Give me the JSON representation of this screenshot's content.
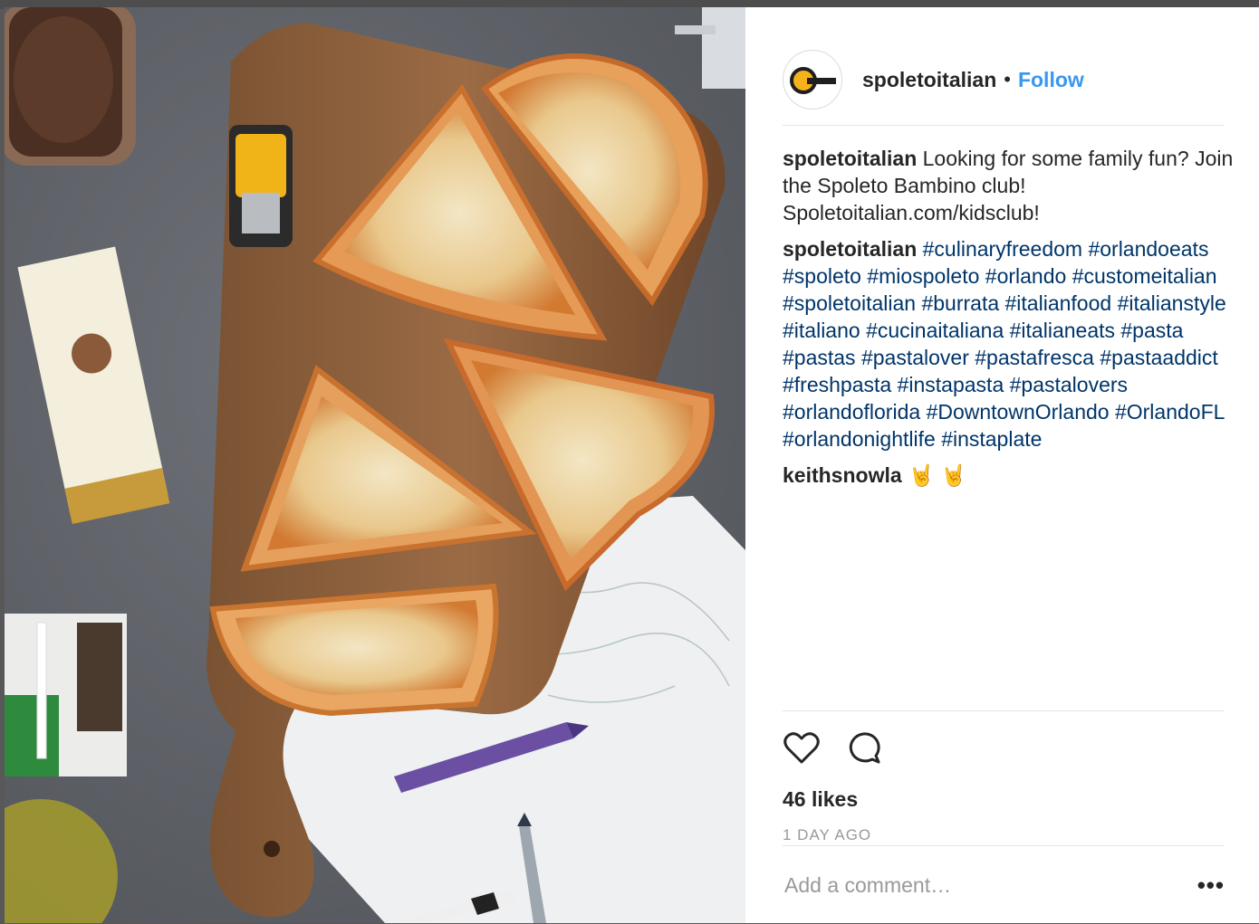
{
  "post": {
    "username": "spoletoitalian",
    "separator": "•",
    "follow_label": "Follow",
    "image_alt": "Pizza slices on a wooden board"
  },
  "comments": [
    {
      "author": "spoletoitalian",
      "text": " Looking for some family fun? Join the Spoleto Bambino club! Spoletoitalian.com/kidsclub!"
    },
    {
      "author": "spoletoitalian",
      "hashtags": [
        "#culinaryfreedom",
        "#orlandoeats",
        "#spoleto",
        "#miospoleto",
        "#orlando",
        "#customeitalian",
        "#spoletoitalian",
        "#burrata",
        "#italianfood",
        "#italianstyle",
        "#italiano",
        "#cucinaitaliana",
        "#italianeats",
        "#pasta",
        "#pastas",
        "#pastalover",
        "#pastafresca",
        "#pastaaddict",
        "#freshpasta",
        "#instapasta",
        "#pastalovers",
        "#orlandoflorida",
        "#DowntownOrlando",
        "#OrlandoFL",
        "#orlandonightlife",
        "#instaplate"
      ]
    },
    {
      "author": "keithsnowla",
      "text": " 🤘 🤘"
    }
  ],
  "actions": {
    "like_icon": "heart-icon",
    "comment_icon": "speech-bubble-icon"
  },
  "likes_text": "46 likes",
  "time_text": "1 DAY AGO",
  "comment_box": {
    "placeholder": "Add a comment…",
    "more_label": "•••"
  },
  "colors": {
    "link": "#3897f0",
    "hashtag": "#003569",
    "text": "#262626",
    "muted": "#999999"
  }
}
